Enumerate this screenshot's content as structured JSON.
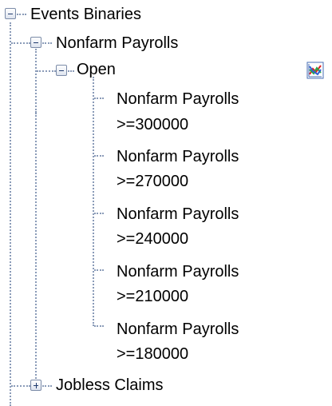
{
  "tree": {
    "root": {
      "label": "Events Binaries",
      "expanded": true,
      "children": [
        {
          "label": "Nonfarm Payrolls",
          "expanded": true,
          "children": [
            {
              "label": "Open",
              "expanded": true,
              "action_icon": "chart-icon",
              "leaves": [
                {
                  "line1": "Nonfarm Payrolls",
                  "line2": ">=300000"
                },
                {
                  "line1": "Nonfarm Payrolls",
                  "line2": ">=270000"
                },
                {
                  "line1": "Nonfarm Payrolls",
                  "line2": ">=240000"
                },
                {
                  "line1": "Nonfarm Payrolls",
                  "line2": ">=210000"
                },
                {
                  "line1": "Nonfarm Payrolls",
                  "line2": ">=180000"
                }
              ]
            }
          ]
        },
        {
          "label": "Jobless Claims",
          "expanded": false
        }
      ]
    }
  },
  "colors": {
    "tree_line": "#8a9bb8",
    "toggle_border": "#7b8ba8",
    "toggle_glyph": "#1f3a6e"
  }
}
